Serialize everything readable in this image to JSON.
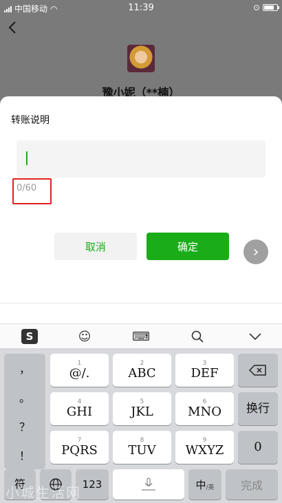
{
  "status_bar": {
    "carrier": "中国移动",
    "time": "11:39"
  },
  "payee_name": "豫小妮（**楠）",
  "dialog": {
    "title": "转账说明",
    "input_value": "",
    "counter": "0/60",
    "cancel_label": "取消",
    "confirm_label": "确定"
  },
  "keyboard": {
    "side_keys": [
      "，",
      "。",
      "？",
      "！"
    ],
    "rows": [
      [
        {
          "num": "1",
          "label": "@/."
        },
        {
          "num": "2",
          "label": "ABC"
        },
        {
          "num": "3",
          "label": "DEF"
        }
      ],
      [
        {
          "num": "4",
          "label": "GHI"
        },
        {
          "num": "5",
          "label": "JKL"
        },
        {
          "num": "6",
          "label": "MNO"
        }
      ],
      [
        {
          "num": "7",
          "label": "PQRS"
        },
        {
          "num": "8",
          "label": "TUV"
        },
        {
          "num": "9",
          "label": "WXYZ"
        }
      ]
    ],
    "newline_label": "换行",
    "zero_label": "0",
    "symbol_label": "符",
    "num_label": "123",
    "lang_label": "中",
    "lang_sub": "/英",
    "done_label": "完成",
    "icons": [
      "sogou-icon",
      "emoji-icon",
      "keyboard-icon",
      "search-icon",
      "collapse-icon"
    ]
  },
  "watermark": "小城生活网"
}
